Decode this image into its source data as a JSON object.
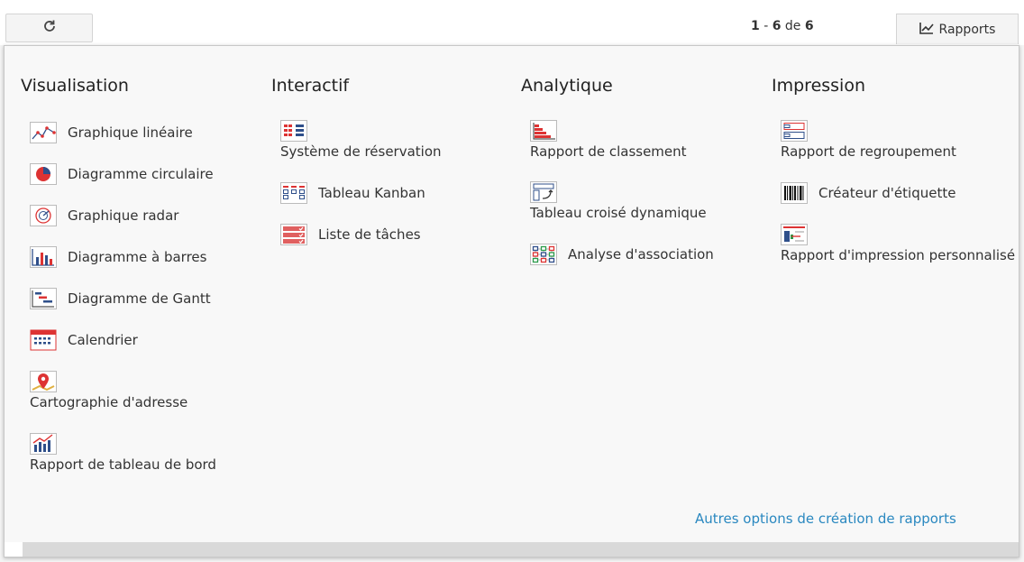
{
  "toolbar": {
    "pager": {
      "start": "1",
      "sep": "-",
      "end": "6",
      "de": "de",
      "total": "6"
    },
    "reports_label": "Rapports"
  },
  "menu": {
    "visualisation": {
      "title": "Visualisation",
      "items": [
        {
          "label": "Graphique linéaire",
          "icon": "line-chart-icon"
        },
        {
          "label": "Diagramme circulaire",
          "icon": "pie-chart-icon"
        },
        {
          "label": "Graphique radar",
          "icon": "radar-chart-icon"
        },
        {
          "label": "Diagramme à barres",
          "icon": "bar-chart-icon"
        },
        {
          "label": "Diagramme de Gantt",
          "icon": "gantt-chart-icon"
        },
        {
          "label": "Calendrier",
          "icon": "calendar-icon"
        },
        {
          "label": "Cartographie d'adresse",
          "icon": "map-pin-icon"
        },
        {
          "label": "Rapport de tableau de bord",
          "icon": "dashboard-icon"
        }
      ]
    },
    "interactif": {
      "title": "Interactif",
      "items": [
        {
          "label": "Système de réservation",
          "icon": "reservation-icon"
        },
        {
          "label": "Tableau Kanban",
          "icon": "kanban-icon"
        },
        {
          "label": "Liste de tâches",
          "icon": "task-list-icon"
        }
      ]
    },
    "analytique": {
      "title": "Analytique",
      "items": [
        {
          "label": "Rapport de classement",
          "icon": "ranking-icon"
        },
        {
          "label": "Tableau croisé dynamique",
          "icon": "pivot-table-icon"
        },
        {
          "label": "Analyse d'association",
          "icon": "association-icon"
        }
      ]
    },
    "impression": {
      "title": "Impression",
      "items": [
        {
          "label": "Rapport de regroupement",
          "icon": "grouping-icon"
        },
        {
          "label": "Créateur d'étiquette",
          "icon": "barcode-icon"
        },
        {
          "label": "Rapport d'impression personnalisé",
          "icon": "custom-print-icon"
        }
      ]
    },
    "more_link": "Autres options de création de rapports"
  }
}
